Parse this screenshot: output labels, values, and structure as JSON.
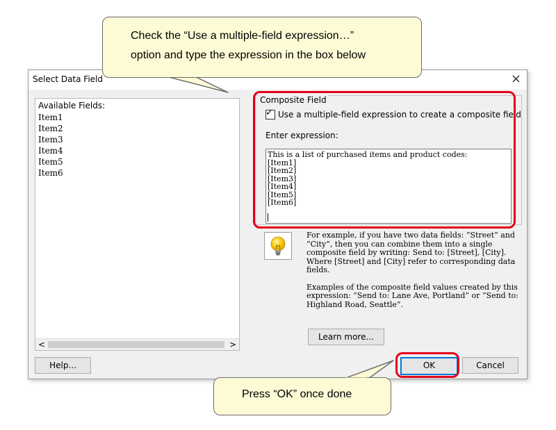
{
  "dialog": {
    "title": "Select Data Field",
    "close_glyph": "×",
    "available_fields": {
      "header": "Available Fields:",
      "items": [
        "Item1",
        "Item2",
        "Item3",
        "Item4",
        "Item5",
        "Item6"
      ],
      "scroll_left": "<",
      "scroll_right": ">"
    },
    "composite": {
      "group_label": "Composite Field",
      "checkbox_checked": true,
      "checkbox_label": "Use a multiple-field expression to create a composite field",
      "expression_label": "Enter expression:",
      "expression_value": "This is a list of purchased items and product codes:\n[Item1]\n[Item2]\n[Item3]\n[Item4]\n[Item5]\n[Item6]"
    },
    "hint": {
      "icon": "lightbulb-icon",
      "paragraph1": "For example, if you have two data fields: “Street” and “City”, then you can combine them into a single composite field by writing: Send to: [Street], [City]. Where [Street] and [City] refer to corresponding data fields.",
      "paragraph2": "Examples of the composite field values created by this expression: “Send to: Lane Ave, Portland” or “Send to: Highland Road, Seattle”.",
      "learn_more": "Learn more..."
    },
    "buttons": {
      "help": "Help...",
      "ok": "OK",
      "cancel": "Cancel"
    }
  },
  "callouts": {
    "top_line1": "Check the “Use a multiple-field expression…”",
    "top_line2": "option and type the expression in the box below",
    "bottom": "Press “OK” once done"
  },
  "colors": {
    "highlight": "#e2001a",
    "callout_bg": "#fdfbd6",
    "focus": "#0078d7"
  }
}
